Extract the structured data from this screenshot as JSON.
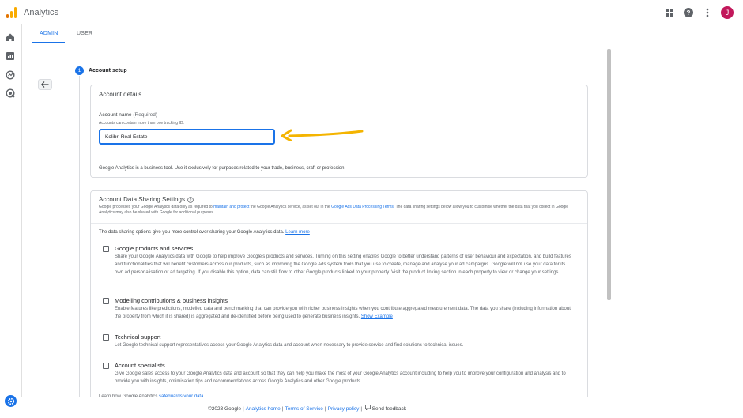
{
  "app": {
    "title": "Analytics",
    "avatar_letter": "J"
  },
  "tabs": [
    {
      "label": "ADMIN"
    },
    {
      "label": "USER"
    }
  ],
  "step": {
    "number": "1",
    "title": "Account setup"
  },
  "account_details": {
    "title": "Account details",
    "name_label": "Account name",
    "required": "(Required)",
    "hint": "Accounts can contain more than one tracking ID.",
    "name_value": "Kolibri Real Estate",
    "business_note": "Google Analytics is a business tool. Use it exclusively for purposes related to your trade, business, craft or profession."
  },
  "sharing": {
    "title": "Account Data Sharing Settings",
    "desc_1": "Google processes your Google Analytics data only as required to ",
    "desc_link_1": "maintain and protect",
    "desc_2": " the Google Analytics service, as set out in the ",
    "desc_link_2": "Google Ads Data Processing Terms",
    "desc_3": ". The data sharing settings below allow you to customise whether the data that you collect in Google Analytics may also be shared with Google for additional purposes.",
    "intro": "The data sharing options give you more control over sharing your Google Analytics data. ",
    "intro_link": "Learn more",
    "options": [
      {
        "title": "Google products and services",
        "desc": "Share your Google Analytics data with Google to help improve Google's products and services. Turning on this setting enables Google to better understand patterns of user behaviour and expectation, and build features and functionalities that will benefit customers across our products, such as improving the Google Ads system tools that you use to create, manage and analyse your ad campaigns. Google will not use your data for its own ad personalisation or ad targeting. If you disable this option, data can still flow to other Google products linked to your property. Visit the product linking section in each property to view or change your settings."
      },
      {
        "title": "Modelling contributions & business insights",
        "desc": "Enable features like predictions, modelled data and benchmarking that can provide you with richer business insights when you contribute aggregated measurement data. The data you share (including information about the property from which it is shared) is aggregated and de-identified before being used to generate business insights. ",
        "link": "Show Example"
      },
      {
        "title": "Technical support",
        "desc": "Let Google technical support representatives access your Google Analytics data and account when necessary to provide service and find solutions to technical issues."
      },
      {
        "title": "Account specialists",
        "desc": "Give Google sales access to your Google Analytics data and account so that they can help you make the most of your Google Analytics account including to help you to improve your configuration and analysis and to provide you with insights, optimisation tips and recommendations across Google Analytics and other Google products."
      }
    ],
    "learn_prefix": "Learn how Google Analytics ",
    "learn_link": "safeguards your data"
  },
  "footer": {
    "copyright": "©2023 Google",
    "home": "Analytics home",
    "terms": "Terms of Service",
    "privacy": "Privacy policy",
    "feedback": "Send feedback"
  },
  "colors": {
    "accent": "#1a73e8",
    "arrow": "#f4b400",
    "avatar": "#c2185b"
  }
}
